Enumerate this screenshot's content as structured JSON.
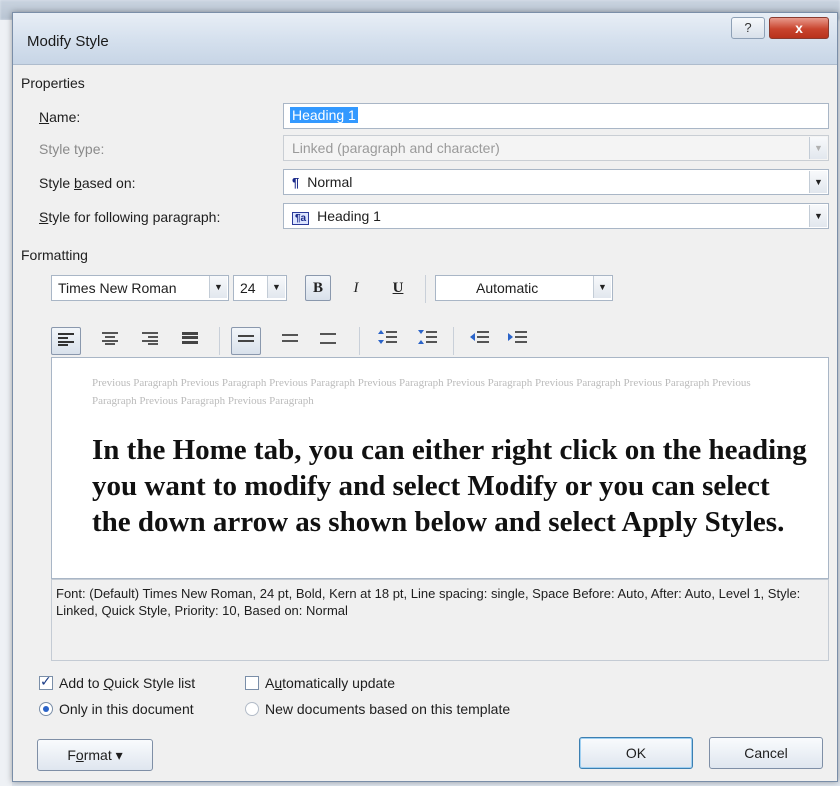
{
  "window": {
    "title": "Modify Style",
    "help_label": "?",
    "close_label": "x"
  },
  "properties": {
    "section_label": "Properties",
    "name_label_pre": "",
    "name_label_u": "N",
    "name_label_post": "ame:",
    "name_value": "Heading 1",
    "style_type_label": "Style type:",
    "style_type_value": "Linked (paragraph and character)",
    "based_on_label_pre": "Style ",
    "based_on_label_u": "b",
    "based_on_label_post": "ased on:",
    "based_on_glyph": "¶",
    "based_on_value": "Normal",
    "following_label_pre": "",
    "following_label_u": "S",
    "following_label_post": "tyle for following paragraph:",
    "following_glyph": "¶a",
    "following_value": "Heading 1"
  },
  "formatting": {
    "section_label": "Formatting",
    "font_name": "Times New Roman",
    "font_size": "24",
    "bold_label": "B",
    "italic_label": "I",
    "underline_label": "U",
    "color_value": "Automatic",
    "icons": [
      "align-left-icon",
      "align-center-icon",
      "align-right-icon",
      "justify-icon",
      "single-spacing-icon",
      "one-half-spacing-icon",
      "double-spacing-icon",
      "increase-paragraph-spacing-icon",
      "decrease-paragraph-spacing-icon",
      "decrease-indent-icon",
      "increase-indent-icon"
    ]
  },
  "preview": {
    "previous_paragraph": "Previous Paragraph Previous Paragraph Previous Paragraph Previous Paragraph Previous Paragraph Previous Paragraph Previous Paragraph Previous Paragraph Previous Paragraph Previous Paragraph",
    "sample_text": "In the Home tab, you can either right click on the heading you want to modify and select Modify or you can select the down arrow as shown below and select Apply Styles."
  },
  "description": "Font: (Default) Times New Roman, 24 pt, Bold, Kern at 18 pt, Line spacing:  single, Space Before: Auto, After:  Auto, Level 1, Style: Linked, Quick Style, Priority: 10, Based on: Normal",
  "options": {
    "quick_style_pre": "Add to ",
    "quick_style_u": "Q",
    "quick_style_post": "uick Style list",
    "quick_style_checked": true,
    "auto_update_pre": "A",
    "auto_update_u": "u",
    "auto_update_post": "tomatically update",
    "auto_update_checked": false,
    "only_doc_label": "Only in this document",
    "new_docs_label": "New documents based on this template",
    "selected_scope": "only_doc"
  },
  "buttons": {
    "format_pre": "F",
    "format_u": "o",
    "format_post": "rmat ▾",
    "ok_label": "OK",
    "cancel_label": "Cancel"
  },
  "colors": {
    "selection": "#3399ff",
    "title_close": "#c9442e"
  }
}
